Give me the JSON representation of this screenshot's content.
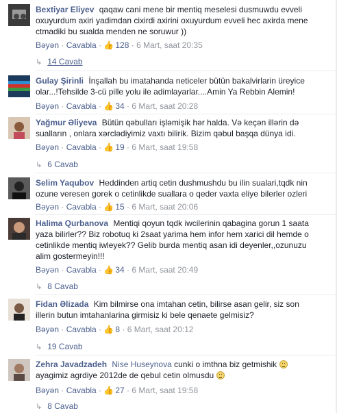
{
  "ui": {
    "like": "Bəyən",
    "reply": "Cavabla",
    "sep": " · "
  },
  "comments": [
    {
      "author": "Bextiyar Eliyev",
      "text": "qaqaw cani mene bir mentiq meselesi dusmuwdu evveli oxuyurdum axiri yadimdan cixirdi axirini oxuyurdum evveli hec axirda mene ctmadiki bu sualda menden ne soruwur ))",
      "likes": "128",
      "time": "6 Mart, saat 20:35",
      "replies": "14 Cavab"
    },
    {
      "author": "Gulay Şirinli",
      "text": "İnşallah bu imatahanda neticeler bütün bakalvirlarin üreyice olar...!Tehsilde 3-cü pille yolu ile adimlayarlar....Amin Ya Rebbin Alemin!",
      "likes": "34",
      "time": "6 Mart, saat 20:28",
      "replies": ""
    },
    {
      "author": "Yağmur Əliyeva",
      "text": "Bütün qəbulları işləmişik hər halda. Və keçən illərin də sualların , onlara xərclədiyimiz vaxtı bilirik. Bizim qəbul başqa dünya idi.",
      "likes": "19",
      "time": "6 Mart, saat 19:58",
      "replies": "6 Cavab"
    },
    {
      "author": "Selim Yaqubov",
      "text": "Heddinden artiq cetin dushmushdu bu ilin sualari,tqdk nin ozune veresen gorek o cetinlikde suallara o qeder vaxta eliye bilerler ozleri",
      "likes": "15",
      "time": "6 Mart, saat 20:06",
      "replies": ""
    },
    {
      "author": "Halima Qurbanova",
      "text": "Mentiqi qoyun tqdk iwcilerinin qabagina gorun 1 saata yaza bilirler?? Biz robotuq ki 2saat yarima hem infor hem xarici dil hemde o cetinlikde mentiq iwleyek?? Gelib burda mentiq asan idi deyenler,,ozunuzu alim gostermeyin!!!",
      "likes": "34",
      "time": "6 Mart, saat 20:49",
      "replies": "8 Cavab"
    },
    {
      "author": "Fidan Əlizada",
      "text": "Kim bilmirse ona imtahan cetin, bilirse asan gelir, siz son illerin butun imtahanlarina girmisiz ki bele qenaete gelmisiz?",
      "likes": "8",
      "time": "6 Mart, saat 20:12",
      "replies": "19 Cavab"
    },
    {
      "author": "Zehra Javadzadeh",
      "tag": "Nise Huseynova",
      "text": "cunki o imthna biz getmishik",
      "text2": "ayagimiz agrdiye 2012de de qebul cetin olmusdu",
      "likes": "27",
      "time": "6 Mart, saat 19:58",
      "replies": "8 Cavab"
    }
  ],
  "icons": {
    "like": "thumbs-up-icon",
    "reply_arrow": "reply-arrow-icon",
    "emoji": "smile-emoji-icon"
  },
  "colors": {
    "link": "#4b5f8d",
    "meta": "#90949c",
    "text": "#1d2129"
  }
}
